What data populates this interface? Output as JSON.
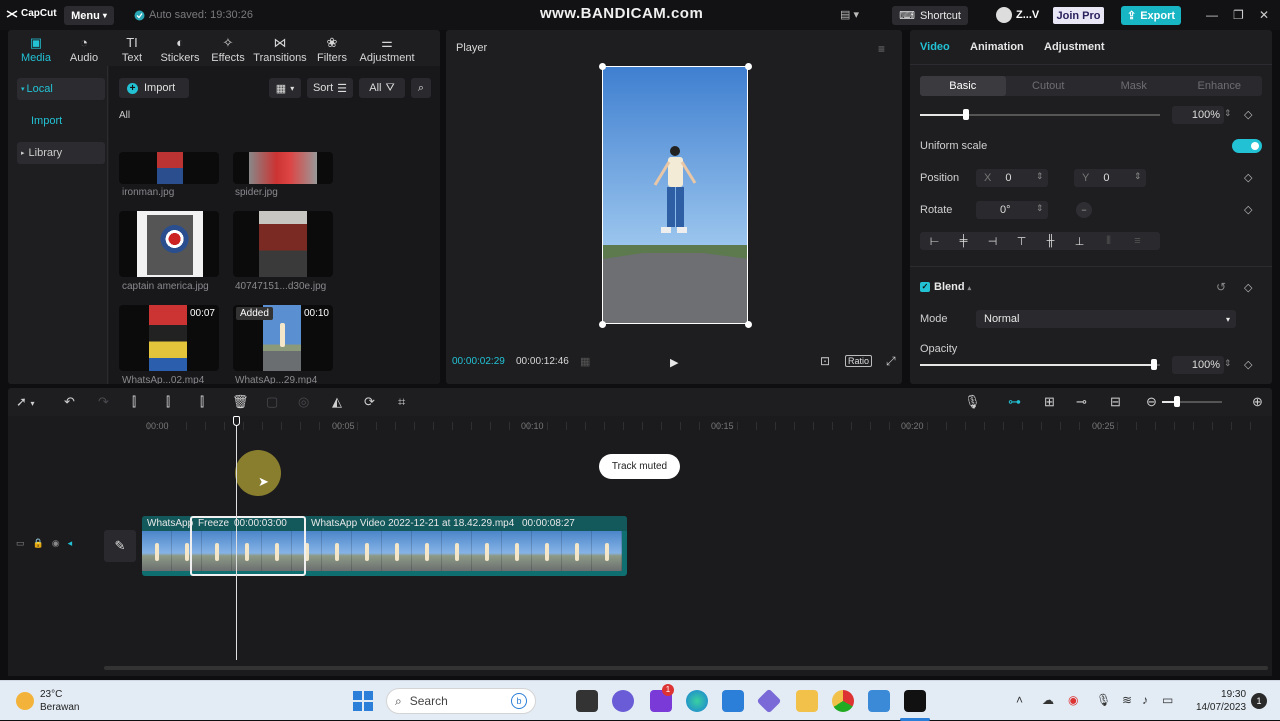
{
  "titlebar": {
    "app_name": "CapCut",
    "menu_label": "Menu",
    "autosave": "Auto saved: 19:30:26",
    "watermark": "www.BANDICAM.com",
    "shortcut_label": "Shortcut",
    "user_name": "Z...V",
    "join_pro_label": "Join Pro",
    "export_label": "Export"
  },
  "media": {
    "tabs": [
      {
        "label": "Media",
        "icon": "media-icon",
        "active": true
      },
      {
        "label": "Audio",
        "icon": "audio-icon"
      },
      {
        "label": "Text",
        "icon": "text-icon"
      },
      {
        "label": "Stickers",
        "icon": "stickers-icon"
      },
      {
        "label": "Effects",
        "icon": "effects-icon"
      },
      {
        "label": "Transitions",
        "icon": "transitions-icon"
      },
      {
        "label": "Filters",
        "icon": "filters-icon"
      },
      {
        "label": "Adjustment",
        "icon": "adjustment-icon"
      }
    ],
    "side": {
      "local": "Local",
      "import": "Import",
      "library": "Library"
    },
    "import_label": "Import",
    "sort_label": "Sort",
    "all_filter_label": "All",
    "all_header": "All",
    "items": [
      {
        "name": "ironman.jpg",
        "duration": "",
        "added": ""
      },
      {
        "name": "spider.jpg",
        "duration": "",
        "added": ""
      },
      {
        "name": "captain america.jpg",
        "duration": "",
        "added": ""
      },
      {
        "name": "40747151...d30e.jpg",
        "duration": "",
        "added": ""
      },
      {
        "name": "WhatsAp...02.mp4",
        "duration": "00:07",
        "added": ""
      },
      {
        "name": "WhatsAp...29.mp4",
        "duration": "00:10",
        "added": "Added"
      }
    ]
  },
  "player": {
    "title": "Player",
    "current_time": "00:00:02:29",
    "total_time": "00:00:12:46",
    "ratio_label": "Ratio"
  },
  "props": {
    "tabs": [
      "Video",
      "Animation",
      "Adjustment"
    ],
    "subtabs": [
      "Basic",
      "Cutout",
      "Mask",
      "Enhance"
    ],
    "scale_pct": "100%",
    "scale_value": 0.1,
    "uniform_scale_label": "Uniform scale",
    "position_label": "Position",
    "pos_x_label": "X",
    "pos_x": "0",
    "pos_y_label": "Y",
    "pos_y": "0",
    "rotate_label": "Rotate",
    "rotate_value": "0°",
    "blend_label": "Blend",
    "mode_label": "Mode",
    "mode_value": "Normal",
    "opacity_label": "Opacity",
    "opacity_pct": "100%"
  },
  "timeline": {
    "ruler": [
      "00:00",
      "00:05",
      "00:10",
      "00:15",
      "00:20",
      "00:25"
    ],
    "toast": "Track muted",
    "clip_prefix": "WhatsApp",
    "freeze_label": "Freeze",
    "freeze_duration": "00:00:03:00",
    "clip_title": "WhatsApp Video 2022-12-21 at 18.42.29.mp4",
    "clip_duration": "00:00:08:27"
  },
  "taskbar": {
    "temp": "23°C",
    "weather": "Berawan",
    "search_placeholder": "Search",
    "time": "19:30",
    "date": "14/07/2023",
    "notification_count": "1",
    "badge_count": "1"
  }
}
